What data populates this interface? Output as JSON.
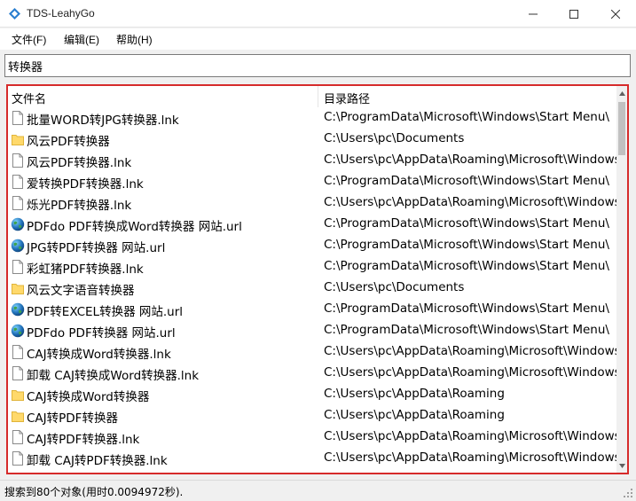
{
  "window": {
    "title": "TDS-LeahyGo"
  },
  "menu": [
    {
      "label": "文件(F)"
    },
    {
      "label": "编辑(E)"
    },
    {
      "label": "帮助(H)"
    }
  ],
  "search": {
    "value": "转换器"
  },
  "table": {
    "columns": [
      "文件名",
      "目录路径"
    ],
    "rows": [
      {
        "icon": "file-icon",
        "name": "批量WORD转JPG转换器.lnk",
        "path": "C:\\ProgramData\\Microsoft\\Windows\\Start Menu\\"
      },
      {
        "icon": "folder-icon",
        "name": "风云PDF转换器",
        "path": "C:\\Users\\pc\\Documents"
      },
      {
        "icon": "file-icon",
        "name": "风云PDF转换器.lnk",
        "path": "C:\\Users\\pc\\AppData\\Roaming\\Microsoft\\Windows"
      },
      {
        "icon": "file-icon",
        "name": "爱转换PDF转换器.lnk",
        "path": "C:\\ProgramData\\Microsoft\\Windows\\Start Menu\\"
      },
      {
        "icon": "file-icon",
        "name": "烁光PDF转换器.lnk",
        "path": "C:\\Users\\pc\\AppData\\Roaming\\Microsoft\\Windows"
      },
      {
        "icon": "globe-icon",
        "name": "PDFdo PDF转换成Word转换器 网站.url",
        "path": "C:\\ProgramData\\Microsoft\\Windows\\Start Menu\\"
      },
      {
        "icon": "globe-icon",
        "name": "JPG转PDF转换器 网站.url",
        "path": "C:\\ProgramData\\Microsoft\\Windows\\Start Menu\\"
      },
      {
        "icon": "file-icon",
        "name": "彩虹猪PDF转换器.lnk",
        "path": "C:\\ProgramData\\Microsoft\\Windows\\Start Menu\\"
      },
      {
        "icon": "folder-icon",
        "name": "风云文字语音转换器",
        "path": "C:\\Users\\pc\\Documents"
      },
      {
        "icon": "globe-icon",
        "name": "PDF转EXCEL转换器 网站.url",
        "path": "C:\\ProgramData\\Microsoft\\Windows\\Start Menu\\"
      },
      {
        "icon": "globe-icon",
        "name": "PDFdo PDF转换器 网站.url",
        "path": "C:\\ProgramData\\Microsoft\\Windows\\Start Menu\\"
      },
      {
        "icon": "file-icon",
        "name": "CAJ转换成Word转换器.lnk",
        "path": "C:\\Users\\pc\\AppData\\Roaming\\Microsoft\\Windows"
      },
      {
        "icon": "file-icon",
        "name": "卸载 CAJ转换成Word转换器.lnk",
        "path": "C:\\Users\\pc\\AppData\\Roaming\\Microsoft\\Windows"
      },
      {
        "icon": "folder-icon",
        "name": "CAJ转换成Word转换器",
        "path": "C:\\Users\\pc\\AppData\\Roaming"
      },
      {
        "icon": "folder-icon",
        "name": "CAJ转PDF转换器",
        "path": "C:\\Users\\pc\\AppData\\Roaming"
      },
      {
        "icon": "file-icon",
        "name": "CAJ转PDF转换器.lnk",
        "path": "C:\\Users\\pc\\AppData\\Roaming\\Microsoft\\Windows"
      },
      {
        "icon": "file-icon",
        "name": "卸载 CAJ转PDF转换器.lnk",
        "path": "C:\\Users\\pc\\AppData\\Roaming\\Microsoft\\Windows"
      }
    ]
  },
  "status": {
    "text": "搜索到80个对象(用时0.0094972秒)."
  },
  "colors": {
    "highlight_border": "#d62b2b",
    "folder": "#ffd96b"
  }
}
